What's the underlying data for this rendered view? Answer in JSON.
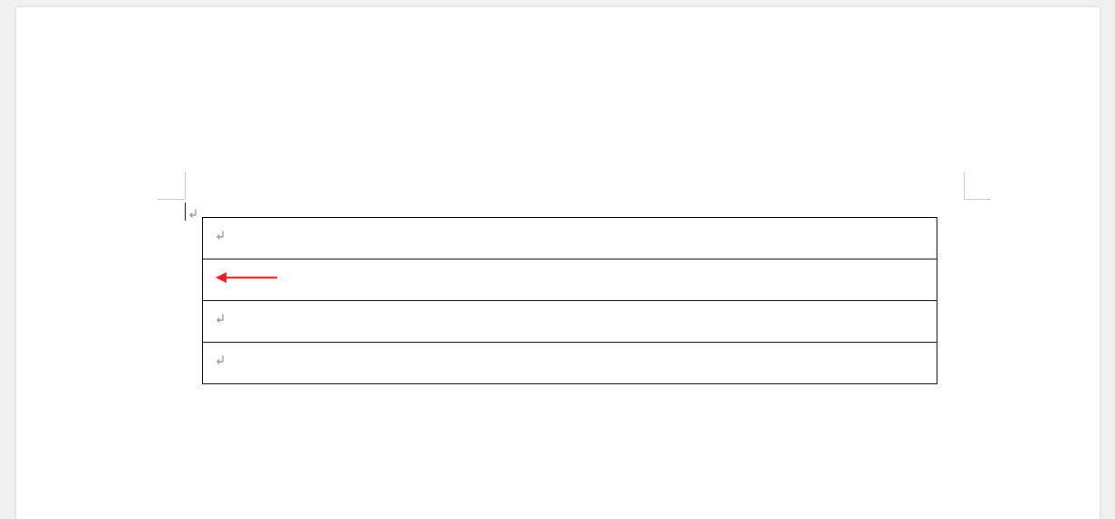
{
  "document": {
    "page_background": "#ffffff",
    "app_background": "#f0f0f0",
    "margin_guide_color": "#c8c8c8",
    "paragraph_mark_color": "#9a9a9a",
    "table": {
      "rows": 4,
      "cells": [
        {
          "content_type": "paragraph_mark"
        },
        {
          "content_type": "arrow_annotation",
          "arrow_color": "#ed1c24",
          "arrow_direction": "left"
        },
        {
          "content_type": "paragraph_mark"
        },
        {
          "content_type": "paragraph_mark"
        }
      ],
      "border_color": "#000000"
    }
  }
}
